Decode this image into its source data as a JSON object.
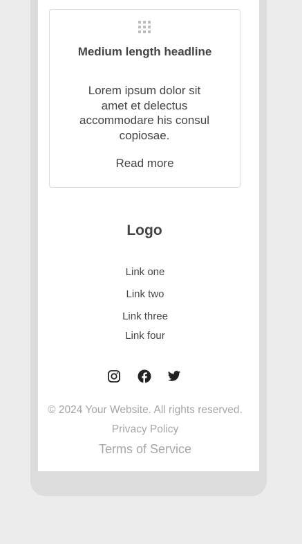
{
  "card": {
    "icon": "grid-icon",
    "title": "Medium length headline",
    "body": "Lorem ipsum dolor sit amet et delectus accommodare his consul copiosae.",
    "read_more": "Read more"
  },
  "footer": {
    "logo": "Logo",
    "links": [
      "Link one",
      "Link two",
      "Link three",
      "Link four"
    ],
    "social": [
      "instagram-icon",
      "facebook-icon",
      "twitter-icon"
    ],
    "copyright": "© 2024 Your Website. All rights reserved.",
    "privacy": "Privacy Policy",
    "terms": "Terms of Service"
  },
  "colors": {
    "page_bg": "#ececec",
    "device_frame": "#dcdcdc",
    "screen_bg": "#ffffff",
    "text": "#444444",
    "muted_text": "#a6a6a6",
    "card_border": "#dadada"
  }
}
